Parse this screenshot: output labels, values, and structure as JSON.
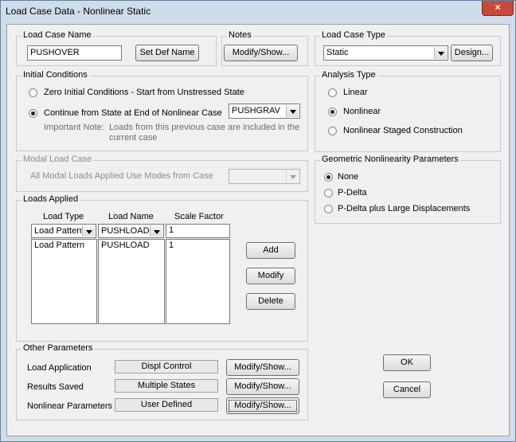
{
  "window": {
    "title": "Load Case Data - Nonlinear Static",
    "close_glyph": "×"
  },
  "load_case_name": {
    "label": "Load Case Name",
    "value": "PUSHOVER",
    "set_def_button": "Set Def Name"
  },
  "notes": {
    "label": "Notes",
    "button": "Modify/Show..."
  },
  "load_case_type": {
    "label": "Load Case Type",
    "value": "Static",
    "design_button": "Design..."
  },
  "initial_conditions": {
    "label": "Initial Conditions",
    "option_zero": "Zero Initial Conditions - Start from Unstressed State",
    "option_continue": "Continue from State at End of Nonlinear Case",
    "selected": "continue",
    "case_value": "PUSHGRAV",
    "note_prefix": "Important Note:",
    "note_line1": "Loads from this previous case are included in the",
    "note_line2": "current case"
  },
  "analysis_type": {
    "label": "Analysis Type",
    "options": [
      "Linear",
      "Nonlinear",
      "Nonlinear Staged Construction"
    ],
    "selected": 1
  },
  "modal_load_case": {
    "label": "Modal Load Case",
    "text": "All Modal Loads Applied Use Modes from Case",
    "value": ""
  },
  "geometric_nonlinearity": {
    "label": "Geometric Nonlinearity Parameters",
    "options": [
      "None",
      "P-Delta",
      "P-Delta plus Large Displacements"
    ],
    "selected": 0
  },
  "loads_applied": {
    "label": "Loads Applied",
    "headers": {
      "type": "Load Type",
      "name": "Load Name",
      "factor": "Scale Factor"
    },
    "input_row": {
      "type": "Load Pattern",
      "name": "PUSHLOAD",
      "factor": "1"
    },
    "rows": [
      {
        "type": "Load Pattern",
        "name": "PUSHLOAD",
        "factor": "1"
      }
    ],
    "add_button": "Add",
    "modify_button": "Modify",
    "delete_button": "Delete"
  },
  "other_parameters": {
    "label": "Other Parameters",
    "rows": [
      {
        "label": "Load Application",
        "value": "Displ Control",
        "button": "Modify/Show..."
      },
      {
        "label": "Results Saved",
        "value": "Multiple States",
        "button": "Modify/Show..."
      },
      {
        "label": "Nonlinear Parameters",
        "value": "User Defined",
        "button": "Modify/Show..."
      }
    ]
  },
  "footer": {
    "ok_button": "OK",
    "cancel_button": "Cancel"
  },
  "colors": {
    "frame": "#cfdcea",
    "face": "#f0f0f0",
    "close": "#c9483c"
  }
}
